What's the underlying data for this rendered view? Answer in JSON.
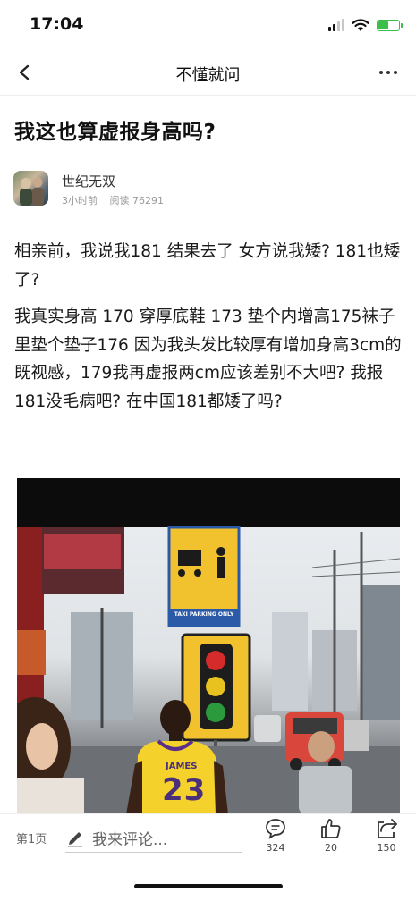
{
  "status_bar": {
    "time": "17:04"
  },
  "nav": {
    "title": "不懂就问"
  },
  "post": {
    "title": "我这也算虚报身高吗?",
    "author": "世纪无双",
    "time_ago": "3小时前",
    "reads": "阅读 76291",
    "paragraphs": [
      "相亲前，我说我181 结果去了 女方说我矮? 181也矮了?",
      "我真实身高 170 穿厚底鞋 173 垫个内增高175袜子里垫个垫子176 因为我头发比较厚有增加身高3cm的既视感，179我再虚报两cm应该差别不大吧? 我报181没毛病吧? 在中国181都矮了吗?"
    ]
  },
  "photo": {
    "sign_text": "TAXI PARKING ONLY",
    "jersey_name": "JAMES",
    "jersey_number": "23"
  },
  "bottom_bar": {
    "page_label": "第1页",
    "comment_placeholder": "我来评论...",
    "comments_count": "324",
    "likes_count": "20",
    "shares_count": "150"
  },
  "colors": {
    "battery": "#3bbf4a",
    "jersey": "#f5d12b",
    "sign": "#f2c12e"
  }
}
